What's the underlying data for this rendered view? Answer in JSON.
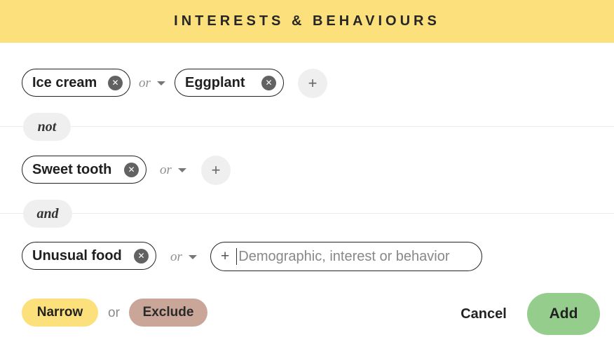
{
  "header": {
    "title": "INTERESTS & BEHAVIOURS"
  },
  "groups": [
    {
      "chips": [
        {
          "label": "Ice cream"
        },
        {
          "label": "Eggplant"
        }
      ],
      "or_label": "or",
      "add_label": "+"
    },
    {
      "joiner": "not",
      "chips": [
        {
          "label": "Sweet tooth"
        }
      ],
      "or_label": "or",
      "add_label": "+"
    },
    {
      "joiner": "and",
      "chips": [
        {
          "label": "Unusual food"
        }
      ],
      "or_label": "or",
      "search": {
        "prefix": "+",
        "placeholder": "Demographic, interest or behavior",
        "value": ""
      }
    }
  ],
  "footer": {
    "narrow_label": "Narrow",
    "or_label": "or",
    "exclude_label": "Exclude",
    "cancel_label": "Cancel",
    "add_label": "Add"
  },
  "colors": {
    "header": "#fbe07b",
    "narrow": "#fbe07b",
    "exclude": "#c9a698",
    "add": "#94cd8c",
    "chip_remove": "#626262"
  }
}
